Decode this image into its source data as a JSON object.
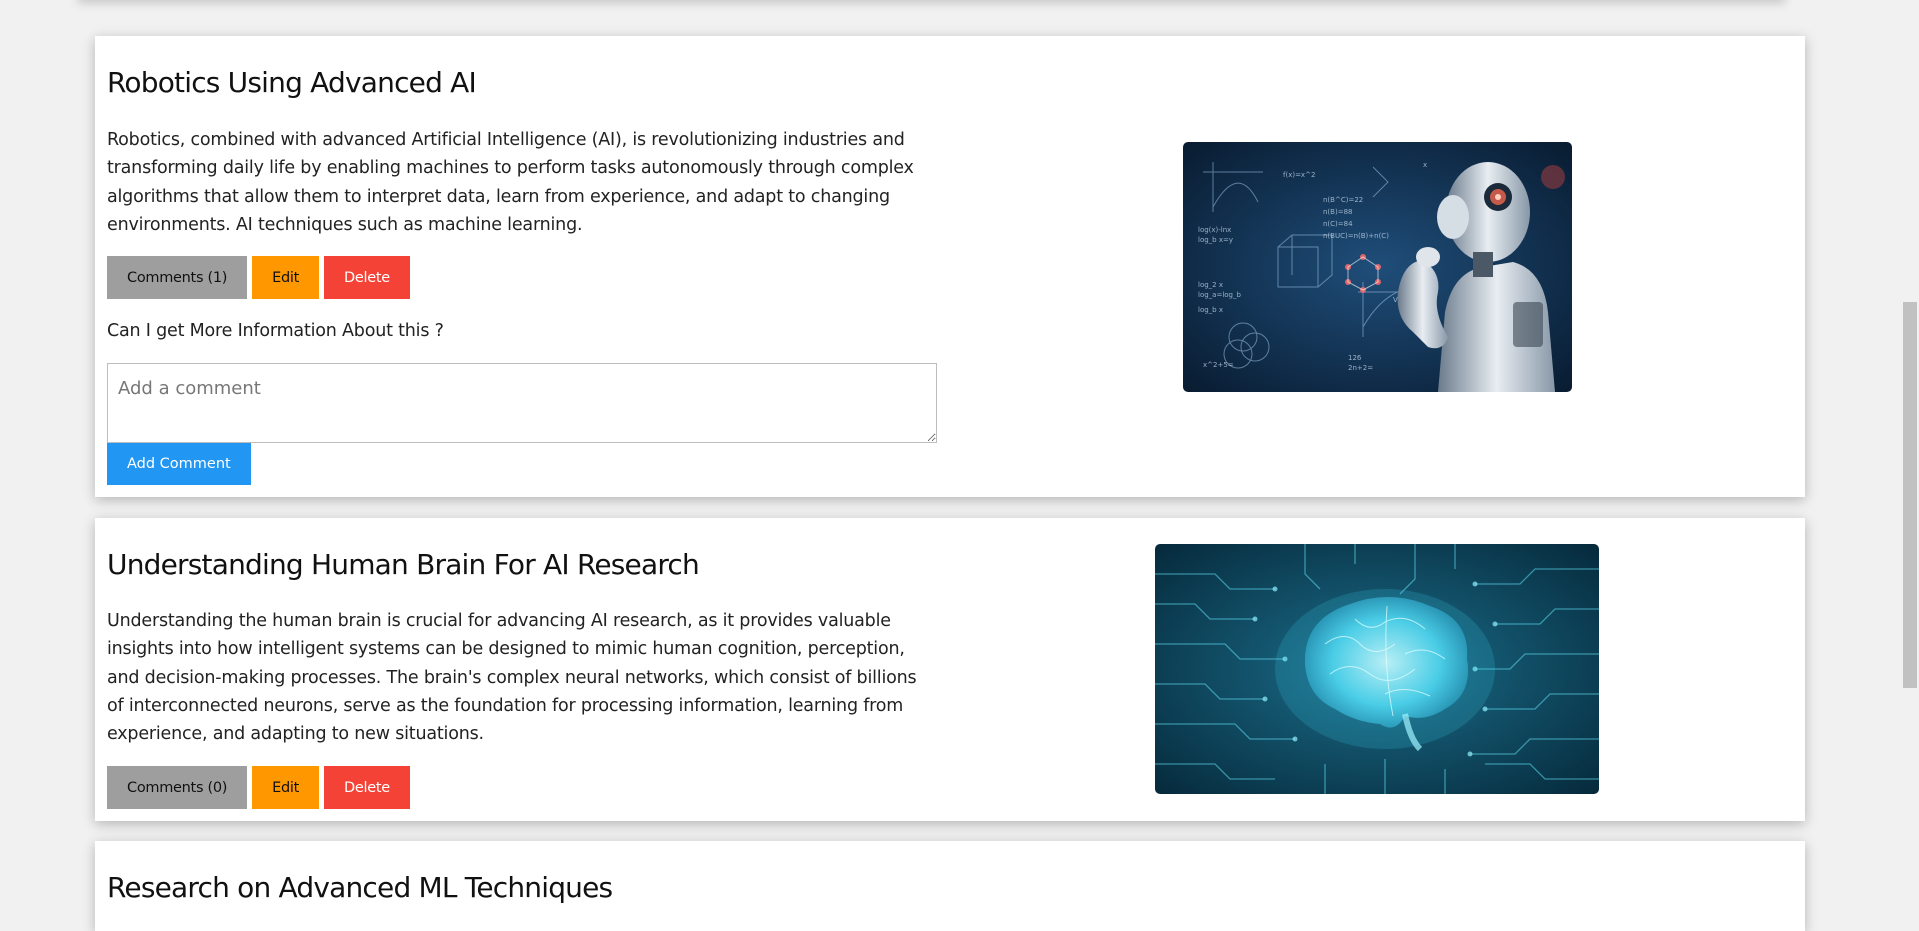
{
  "posts": [
    {
      "title": "Robotics Using Advanced AI",
      "body": "Robotics, combined with advanced Artificial Intelligence (AI), is revolutionizing industries and transforming daily life by enabling machines to perform tasks autonomously through complex algorithms that allow them to interpret data, learn from experience, and adapt to changing environments. AI techniques such as machine learning.",
      "comments_label": "Comments (1)",
      "edit_label": "Edit",
      "delete_label": "Delete",
      "comments": [
        "Can I get More Information About this ?"
      ],
      "comment_placeholder": "Add a comment",
      "add_comment_label": "Add Comment",
      "image": "robot-with-equations-illustration"
    },
    {
      "title": "Understanding Human Brain For AI Research",
      "body": "Understanding the human brain is crucial for advancing AI research, as it provides valuable insights into how intelligent systems can be designed to mimic human cognition, perception, and decision-making processes. The brain's complex neural networks, which consist of billions of interconnected neurons, serve as the foundation for processing information, learning from experience, and adapting to new situations.",
      "comments_label": "Comments (0)",
      "edit_label": "Edit",
      "delete_label": "Delete",
      "image": "glowing-brain-circuit-illustration"
    },
    {
      "title": "Research on Advanced ML Techniques"
    }
  ],
  "colors": {
    "comments_button": "#9e9e9e",
    "edit_button": "#ff9800",
    "delete_button": "#f44336",
    "add_comment_button": "#2196f3",
    "page_background": "#f1f1f1"
  }
}
